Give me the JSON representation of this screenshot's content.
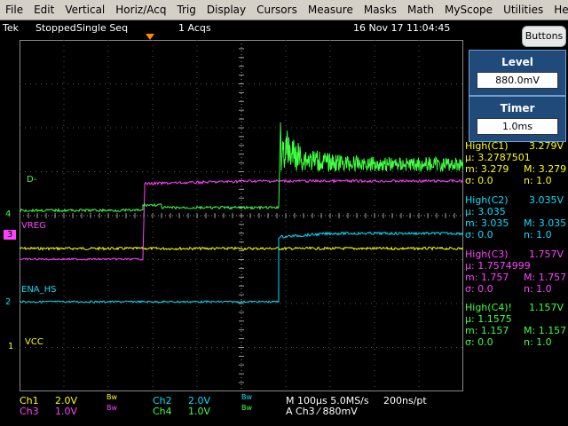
{
  "menubar": {
    "items": [
      "File",
      "Edit",
      "Vertical",
      "Horiz/Acq",
      "Trig",
      "Display",
      "Cursors",
      "Measure",
      "Masks",
      "Math",
      "MyScope",
      "Utilities",
      "Help"
    ]
  },
  "status": {
    "brand": "Tek",
    "state": "Stopped",
    "mode": "Single Seq",
    "acqs": "1 Acqs",
    "datetime": "16 Nov 17 11:04:45"
  },
  "buttons_label": "Buttons",
  "level": {
    "title": "Level",
    "value": "880.0mV"
  },
  "timer": {
    "title": "Timer",
    "value": "1.0ms"
  },
  "measurements": [
    {
      "title": "High(C1)",
      "value": "3.279V",
      "mu": "µ: 3.2787501",
      "m": "m: 3.279",
      "M": "M: 3.279",
      "sigma": "σ: 0.0",
      "n": "n: 1.0",
      "color": "#ffff00"
    },
    {
      "title": "High(C2)",
      "value": "3.035V",
      "mu": "µ: 3.035",
      "m": "m: 3.035",
      "M": "M: 3.035",
      "sigma": "σ: 0.0",
      "n": "n: 1.0",
      "color": "#00e0ff"
    },
    {
      "title": "High(C3)",
      "value": "1.757V",
      "mu": "µ: 1.7574999",
      "m": "m: 1.757",
      "M": "M: 1.757",
      "sigma": "σ: 0.0",
      "n": "n: 1.0",
      "color": "#ff40ff"
    },
    {
      "title": "High(C4)!",
      "value": "1.157V",
      "mu": "µ: 1.1575",
      "m": "m: 1.157",
      "M": "M: 1.157",
      "sigma": "σ: 0.0",
      "n": "n: 1.0",
      "color": "#40ff40"
    }
  ],
  "trace_labels": {
    "d": "D-",
    "vreg": "VREG",
    "ena": "ENA_HS",
    "vcc": "VCC"
  },
  "ground_markers": {
    "ch4": "4",
    "ch3": "3",
    "ch2": "2",
    "ch1": "1"
  },
  "bottom": {
    "ch1_name": "Ch1",
    "ch1_scale": "2.0V",
    "ch1_bw": "Bw",
    "ch2_name": "Ch2",
    "ch2_scale": "2.0V",
    "ch2_bw": "Bw",
    "ch3_name": "Ch3",
    "ch3_scale": "1.0V",
    "ch3_bw": "Bw",
    "ch4_name": "Ch4",
    "ch4_scale": "1.0V",
    "ch4_bw": "Bw",
    "timebase": "M 100µs 5.0MS/s",
    "resolution": "200ns/pt",
    "trigger": "A  Ch3  ⁄  880mV"
  },
  "colors": {
    "ch1": "#ffff00",
    "ch2": "#00e0ff",
    "ch3": "#ff40ff",
    "ch4": "#40ff40",
    "trigger": "#ff8c00"
  }
}
